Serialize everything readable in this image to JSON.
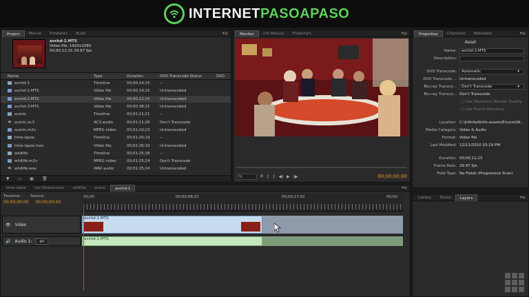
{
  "banner": {
    "brand_white": "INTERNET",
    "brand_green": "PASOAPASO"
  },
  "project_panel": {
    "tabs": [
      "Project",
      "Menus",
      "Timelines",
      "Build"
    ],
    "preview": {
      "name": "avchd-2.MTS",
      "line2": "Video file, 1920x1080",
      "line3": "00;00;11;15 29.97 fps"
    },
    "columns": [
      "Name",
      "Type",
      "Duration",
      "DVD Transcode Status",
      "DVD"
    ],
    "rows": [
      {
        "name": "avchd-1",
        "type": "Timeline",
        "duration": "00;00;14;15",
        "status": "--",
        "icon": "timeline"
      },
      {
        "name": "avchd-1.MTS",
        "type": "Video file",
        "duration": "00;00;14;15",
        "status": "Untranscoded",
        "icon": "video"
      },
      {
        "name": "avchd-2.MTS",
        "type": "Video file",
        "duration": "00;00;11;15",
        "status": "Untranscoded",
        "icon": "video"
      },
      {
        "name": "avchd-3.MTS",
        "type": "Video file",
        "duration": "00;00;38;15",
        "status": "Untranscoded",
        "icon": "video"
      },
      {
        "name": "scenic",
        "type": "Timeline",
        "duration": "00;01;11;21",
        "status": "--",
        "icon": "timeline"
      },
      {
        "name": "scenic.ac3",
        "type": "AC3 audio",
        "duration": "00;01;11;28",
        "status": "Don't Transcode",
        "icon": "audio"
      },
      {
        "name": "scenic.m2v",
        "type": "MPEG video",
        "duration": "00;01;10;23",
        "status": "Untranscoded",
        "icon": "video"
      },
      {
        "name": "time-lapse",
        "type": "Timeline",
        "duration": "00;01;26;19",
        "status": "--",
        "icon": "timeline"
      },
      {
        "name": "time-lapse.mov",
        "type": "Video file",
        "duration": "00;01;26;19",
        "status": "Untranscoded",
        "icon": "video"
      },
      {
        "name": "wildlife",
        "type": "Timeline",
        "duration": "00;01;25;18",
        "status": "--",
        "icon": "timeline"
      },
      {
        "name": "wildlife.m2v",
        "type": "MPEG video",
        "duration": "00;01;25;24",
        "status": "Don't Transcode",
        "icon": "video"
      },
      {
        "name": "wildlife.wav",
        "type": "WAV audio",
        "duration": "00;01;25;24",
        "status": "Untranscoded",
        "icon": "audio"
      }
    ],
    "selected_index": 2
  },
  "monitor_panel": {
    "tabs": [
      "Monitor",
      "(no Menus)",
      "Flowchart"
    ],
    "fit_label": "Fit",
    "timecode": "00;00;00;00"
  },
  "properties_panel": {
    "tabs": [
      "Properties",
      "Character",
      "Metadata"
    ],
    "title": "Asset",
    "name_label": "Name:",
    "name_value": "avchd-2.MTS",
    "description_label": "Description:",
    "dvd_transcode_label": "DVD Transcode:",
    "dvd_transcode_value": "Automatic",
    "dvd_transcode_status_label": "DVD Transcode ...",
    "dvd_transcode_status_value": "Untranscoded",
    "bluray_transcode_label": "Blu-ray Transco...",
    "bluray_transcode_value": "Don't Transcode",
    "bluray_transcode2_label": "Blu-ray Transco...",
    "bluray_transcode2_value": "Don't Transcode",
    "max_render_quality": "Use Maximum Render Quality",
    "frame_blending": "Use Frame Blending",
    "location_label": "Location:",
    "location_value": "C:\\InfiniteSkills-assets\\Encore\\W...",
    "media_category_label": "Media Category:",
    "media_category_value": "Video & Audio",
    "format_label": "Format:",
    "format_value": "Video file",
    "last_modified_label": "Last Modified:",
    "last_modified_value": "12/11/2010 03:19 PM",
    "duration_label": "Duration:",
    "duration_value": "00;00;11;15",
    "frame_rate_label": "Frame Rate:",
    "frame_rate_value": "29.97 fps",
    "field_type_label": "Field Type:",
    "field_type_value": "No Fields (Progressive Scan)"
  },
  "timeline_panel": {
    "tabs": [
      "time-lapse",
      "(no Slideshows)",
      "wildlife",
      "scenic",
      "avchd-1"
    ],
    "timeline_label": "Timeline:",
    "source_label": "Source:",
    "timeline_tc": "00;00;00;00",
    "source_tc": "00;00;00;00",
    "ruler_labels": [
      "00;00",
      "00;00;08;15",
      "00;00;17;02",
      "00;00"
    ],
    "video_track_label": "Video",
    "audio_track_label": "Audio 1:",
    "audio_lang": "en",
    "video_clip_name": "avchd-1.MTS",
    "audio_clip_name": "avchd-1.MTS"
  },
  "layers_panel": {
    "tabs": [
      "Library",
      "Styles",
      "Layers"
    ]
  },
  "colors": {
    "brand_green": "#5dd15a",
    "timecode_orange": "#e89b2a",
    "video_clip": "#c8dcef",
    "audio_clip": "#c6e6bf"
  }
}
